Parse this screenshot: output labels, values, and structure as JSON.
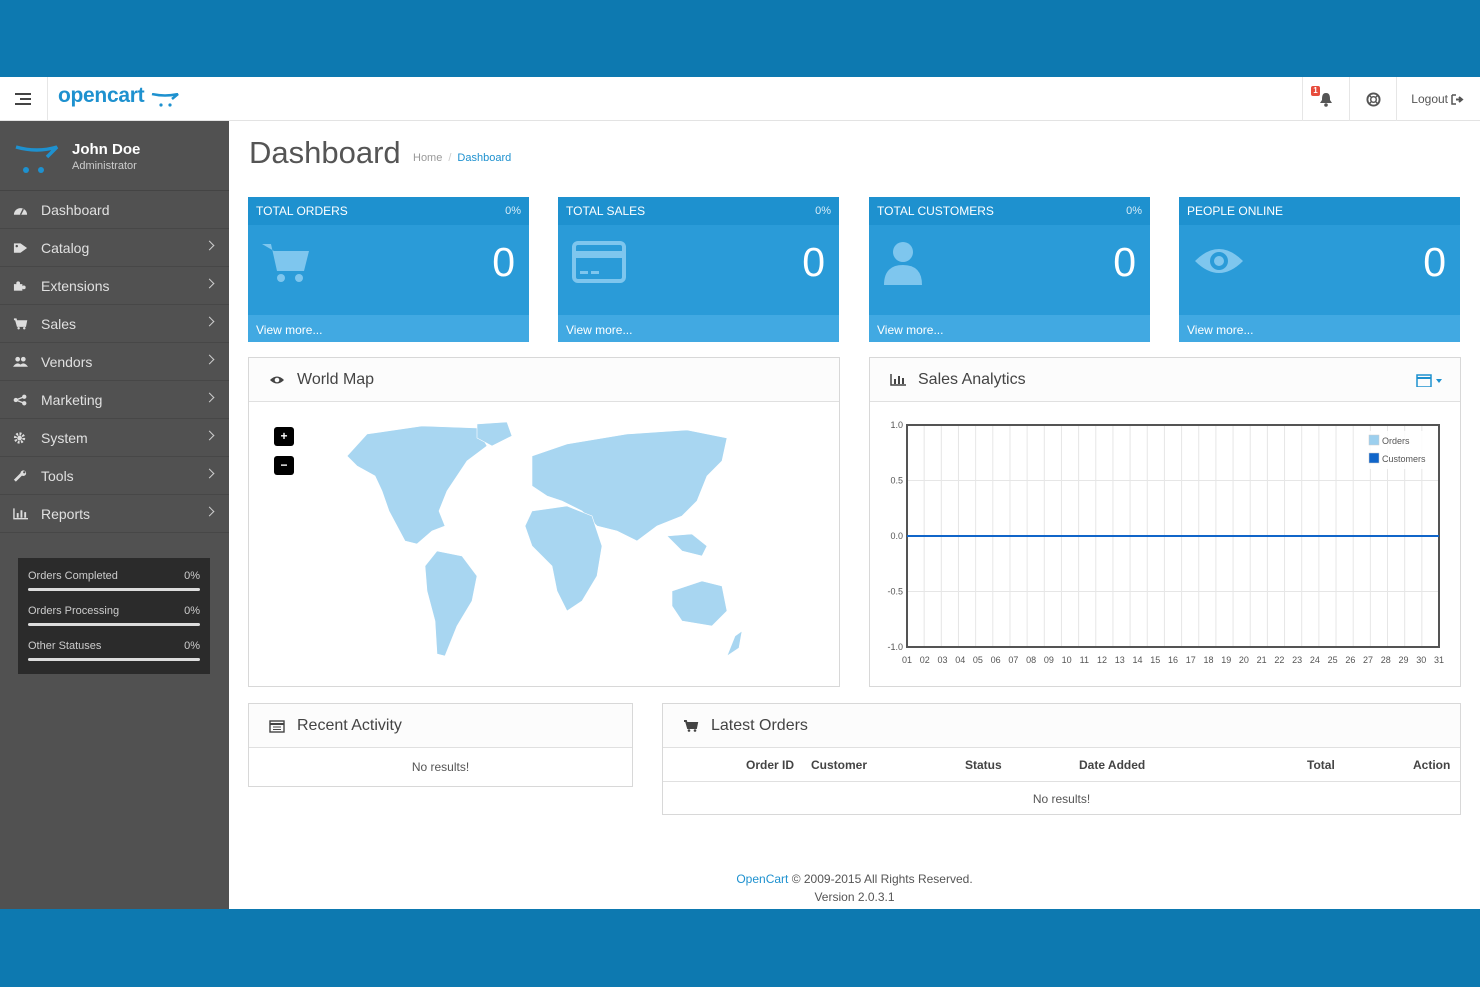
{
  "header": {
    "logo": "opencart",
    "notification_count": "1",
    "logout_label": "Logout"
  },
  "profile": {
    "name": "John Doe",
    "role": "Administrator"
  },
  "sidebar": {
    "items": [
      {
        "label": "Dashboard",
        "icon": "dashboard-icon"
      },
      {
        "label": "Catalog",
        "icon": "tag-icon"
      },
      {
        "label": "Extensions",
        "icon": "puzzle-icon"
      },
      {
        "label": "Sales",
        "icon": "cart-icon"
      },
      {
        "label": "Vendors",
        "icon": "users-icon"
      },
      {
        "label": "Marketing",
        "icon": "share-icon"
      },
      {
        "label": "System",
        "icon": "cog-icon"
      },
      {
        "label": "Tools",
        "icon": "wrench-icon"
      },
      {
        "label": "Reports",
        "icon": "bar-chart-icon"
      }
    ],
    "stats": [
      {
        "label": "Orders Completed",
        "percent": "0%",
        "progress": 0
      },
      {
        "label": "Orders Processing",
        "percent": "0%",
        "progress": 0
      },
      {
        "label": "Other Statuses",
        "percent": "0%",
        "progress": 0
      }
    ]
  },
  "page": {
    "title": "Dashboard",
    "breadcrumb": [
      "Home",
      "Dashboard"
    ]
  },
  "tiles": [
    {
      "title": "TOTAL ORDERS",
      "percent": "0%",
      "value": "0",
      "more": "View more...",
      "icon": "cart-icon"
    },
    {
      "title": "TOTAL SALES",
      "percent": "0%",
      "value": "0",
      "more": "View more...",
      "icon": "credit-card-icon"
    },
    {
      "title": "TOTAL CUSTOMERS",
      "percent": "0%",
      "value": "0",
      "more": "View more...",
      "icon": "user-icon"
    },
    {
      "title": "PEOPLE ONLINE",
      "percent": "",
      "value": "0",
      "more": "View more...",
      "icon": "eye-icon"
    }
  ],
  "world_map": {
    "title": "World Map",
    "zoom_in": "+",
    "zoom_out": "−"
  },
  "analytics": {
    "title": "Sales Analytics"
  },
  "chart_data": {
    "type": "line",
    "x": [
      "01",
      "02",
      "03",
      "04",
      "05",
      "06",
      "07",
      "08",
      "09",
      "10",
      "11",
      "12",
      "13",
      "14",
      "15",
      "16",
      "17",
      "18",
      "19",
      "20",
      "21",
      "22",
      "23",
      "24",
      "25",
      "26",
      "27",
      "28",
      "29",
      "30",
      "31"
    ],
    "series": [
      {
        "name": "Orders",
        "values": [
          0,
          0,
          0,
          0,
          0,
          0,
          0,
          0,
          0,
          0,
          0,
          0,
          0,
          0,
          0,
          0,
          0,
          0,
          0,
          0,
          0,
          0,
          0,
          0,
          0,
          0,
          0,
          0,
          0,
          0,
          0
        ],
        "color": "#9ccfee"
      },
      {
        "name": "Customers",
        "values": [
          0,
          0,
          0,
          0,
          0,
          0,
          0,
          0,
          0,
          0,
          0,
          0,
          0,
          0,
          0,
          0,
          0,
          0,
          0,
          0,
          0,
          0,
          0,
          0,
          0,
          0,
          0,
          0,
          0,
          0,
          0
        ],
        "color": "#1065c9"
      }
    ],
    "yticks": [
      "1.0",
      "0.5",
      "0.0",
      "-0.5",
      "-1.0"
    ],
    "ylim": [
      -1,
      1
    ],
    "grid": true,
    "legend": "top-right"
  },
  "recent_activity": {
    "title": "Recent Activity",
    "empty": "No results!"
  },
  "latest_orders": {
    "title": "Latest Orders",
    "columns": [
      "Order ID",
      "Customer",
      "Status",
      "Date Added",
      "Total",
      "Action"
    ],
    "empty": "No results!"
  },
  "footer": {
    "brand": "OpenCart",
    "copyright": " © 2009-2015 All Rights Reserved.",
    "version": "Version 2.0.3.1"
  },
  "colors": {
    "accent": "#1e91cf",
    "tile": "#2a9bd8",
    "sidebar": "#515151"
  }
}
